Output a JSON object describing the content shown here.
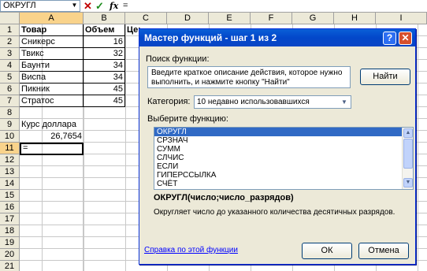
{
  "formula_bar": {
    "name_box": "ОКРУГЛ",
    "cancel_icon": "x-icon",
    "enter_icon": "check-icon",
    "fx_label": "fx",
    "formula_text": "="
  },
  "columns": [
    "A",
    "B",
    "C",
    "D",
    "E",
    "F",
    "G",
    "H",
    "I"
  ],
  "rows": [
    "1",
    "2",
    "3",
    "4",
    "5",
    "6",
    "7",
    "8",
    "9",
    "10",
    "11",
    "12",
    "13",
    "14",
    "15",
    "16",
    "17",
    "18",
    "19",
    "20",
    "21"
  ],
  "cells": {
    "a1": "Товар",
    "b1": "Объем",
    "c1": "Цен",
    "a2": "Сникерс",
    "b2": "16",
    "a3": "Твикс",
    "b3": "32",
    "a4": "Баунти",
    "b4": "34",
    "a5": "Виспа",
    "b5": "34",
    "a6": "Пикник",
    "b6": "45",
    "a7": "Стратос",
    "b7": "45",
    "a9": "Курс доллара",
    "b10": "26,7654",
    "a11": "="
  },
  "dialog": {
    "title": "Мастер функций - шаг 1 из 2",
    "help_btn": "?",
    "close_btn": "✕",
    "search_label": "Поиск функции:",
    "search_placeholder": "Введите краткое описание действия, которое нужно выполнить, и нажмите кнопку \"Найти\"",
    "find_button": "Найти",
    "category_label": "Категория:",
    "category_value": "10 недавно использовавшихся",
    "choose_label": "Выберите функцию:",
    "functions": [
      "ОКРУГЛ",
      "СРЗНАЧ",
      "СУММ",
      "СЛЧИС",
      "ЕСЛИ",
      "ГИПЕРССЫЛКА",
      "СЧЁТ"
    ],
    "selected_function": "ОКРУГЛ",
    "syntax": "ОКРУГЛ(число;число_разрядов)",
    "description": "Округляет число до указанного количества десятичных разрядов.",
    "help_link": "Справка по этой функции",
    "ok_button": "ОК",
    "cancel_button": "Отмена"
  }
}
